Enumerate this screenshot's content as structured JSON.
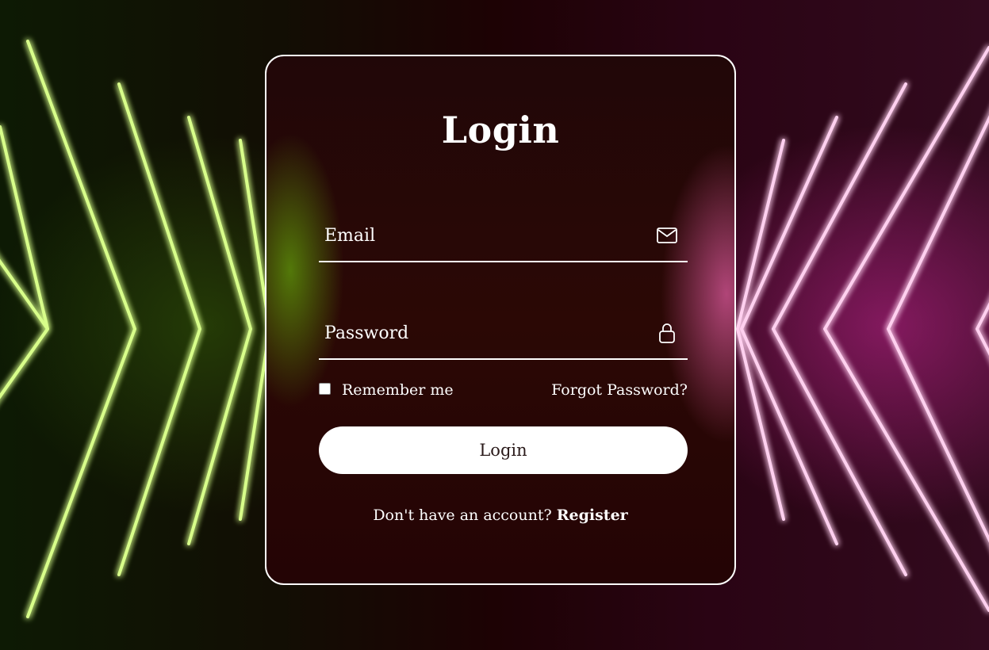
{
  "login_form": {
    "title": "Login",
    "email": {
      "placeholder": "Email",
      "value": "",
      "icon": "envelope-icon"
    },
    "password": {
      "placeholder": "Password",
      "value": "",
      "icon": "lock-icon"
    },
    "remember_label": "Remember me",
    "remember_checked": false,
    "forgot_label": "Forgot Password?",
    "submit_label": "Login",
    "register_prompt": "Don't have an account?",
    "register_label": "Register"
  },
  "colors": {
    "card_border": "#ffffff",
    "button_bg": "#ffffff",
    "neon_green": "#b8ff4a",
    "neon_pink": "#ff5ac0"
  }
}
